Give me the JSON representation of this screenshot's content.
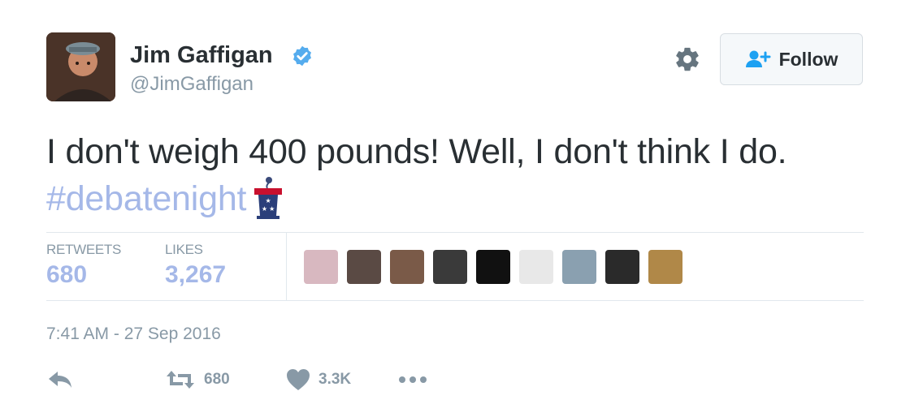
{
  "author": {
    "name": "Jim Gaffigan",
    "handle": "@JimGaffigan",
    "verified": true,
    "avatar_icon": "avatar-photo"
  },
  "header": {
    "settings_icon": "gear-icon",
    "follow_label": "Follow",
    "follow_icon": "add-user-icon"
  },
  "tweet": {
    "text": "I don't weigh 400 pounds! Well,  I don't think I do.",
    "hashtag": "#debatenight",
    "hashtag_emoji": "podium-icon"
  },
  "stats": {
    "retweets_label": "RETWEETS",
    "retweets_value": "680",
    "likes_label": "LIKES",
    "likes_value": "3,267"
  },
  "likers": [
    {
      "name": "liker-1",
      "color": "#d8b8c0"
    },
    {
      "name": "liker-2",
      "color": "#5a4a44"
    },
    {
      "name": "liker-3",
      "color": "#7a5a48"
    },
    {
      "name": "liker-4",
      "color": "#3a3a3a"
    },
    {
      "name": "liker-5",
      "color": "#111111"
    },
    {
      "name": "liker-6",
      "color": "#e8e8e8"
    },
    {
      "name": "liker-7",
      "color": "#8aa0b0"
    },
    {
      "name": "liker-8",
      "color": "#2a2a2a"
    },
    {
      "name": "liker-9",
      "color": "#b08848"
    }
  ],
  "timestamp": "7:41 AM - 27 Sep 2016",
  "actions": {
    "reply_icon": "reply-icon",
    "retweet_icon": "retweet-icon",
    "retweet_count": "680",
    "like_icon": "heart-icon",
    "like_count": "3.3K",
    "more_icon": "more-icon"
  },
  "colors": {
    "text": "#292f33",
    "muted": "#8899a6",
    "link": "#a5b8e8",
    "verified": "#55acee",
    "divider": "#e1e8ed"
  }
}
